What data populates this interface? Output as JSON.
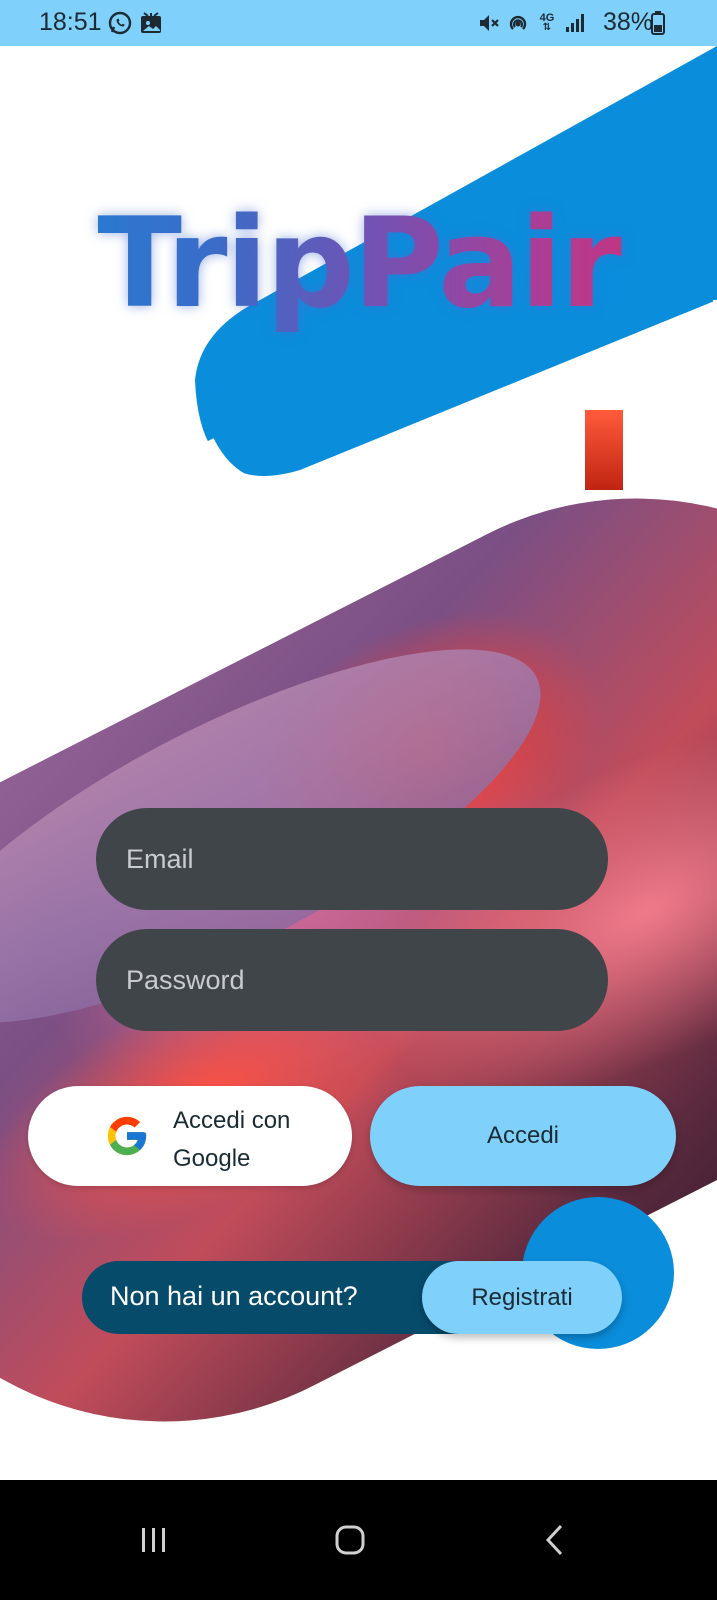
{
  "status_bar": {
    "time": "18:51",
    "network": "4G",
    "battery": "38%",
    "icons": [
      "whatsapp-icon",
      "gallery-icon",
      "mute-icon",
      "hotspot-icon",
      "network-4g-icon",
      "signal-icon",
      "battery-icon"
    ]
  },
  "app": {
    "title": "TripPair"
  },
  "login_form": {
    "email_placeholder": "Email",
    "password_placeholder": "Password",
    "google_label": "Accedi con Google",
    "login_label": "Accedi"
  },
  "signup": {
    "prompt": "Non hai un account?",
    "button_label": "Registrati"
  },
  "nav_bar": {
    "buttons": [
      "recent-apps-icon",
      "home-icon",
      "back-icon"
    ]
  },
  "colors": {
    "accent_light": "#7fd1fb",
    "accent_blue": "#0a8ddb",
    "dark_teal": "#074b6b",
    "field_bg": "#40454a"
  }
}
